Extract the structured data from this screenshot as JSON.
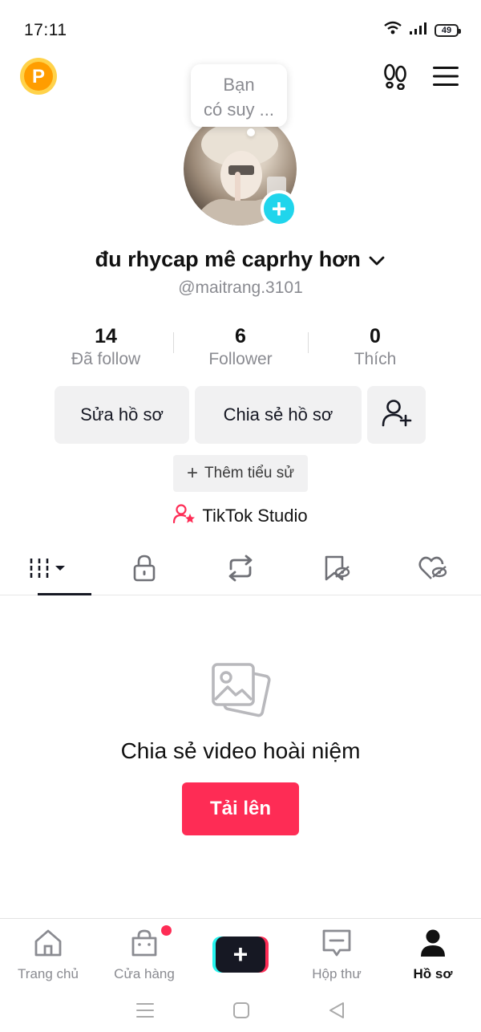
{
  "status_bar": {
    "time": "17:11",
    "battery": "49"
  },
  "profile": {
    "bubble_text_1": "Bạn",
    "bubble_text_2": "có suy ...",
    "display_name": "đu rhycap mê caprhy hơn",
    "username": "@maitrang.3101"
  },
  "stats": [
    {
      "value": "14",
      "label": "Đã follow"
    },
    {
      "value": "6",
      "label": "Follower"
    },
    {
      "value": "0",
      "label": "Thích"
    }
  ],
  "actions": {
    "edit_profile": "Sửa hồ sơ",
    "share_profile": "Chia sẻ hồ sơ",
    "add_bio": "Thêm tiểu sử",
    "studio": "TikTok Studio"
  },
  "empty_state": {
    "title": "Chia sẻ video hoài niệm",
    "upload": "Tải lên"
  },
  "bottom_nav": [
    {
      "label": "Trang chủ",
      "icon": "home-icon"
    },
    {
      "label": "Cửa hàng",
      "icon": "shop-icon"
    },
    {
      "label": "",
      "icon": "create-icon"
    },
    {
      "label": "Hộp thư",
      "icon": "inbox-icon"
    },
    {
      "label": "Hồ sơ",
      "icon": "profile-icon"
    }
  ],
  "colors": {
    "accent": "#fe2c55",
    "cyan": "#20d5ec",
    "coin": "#ffb800"
  }
}
